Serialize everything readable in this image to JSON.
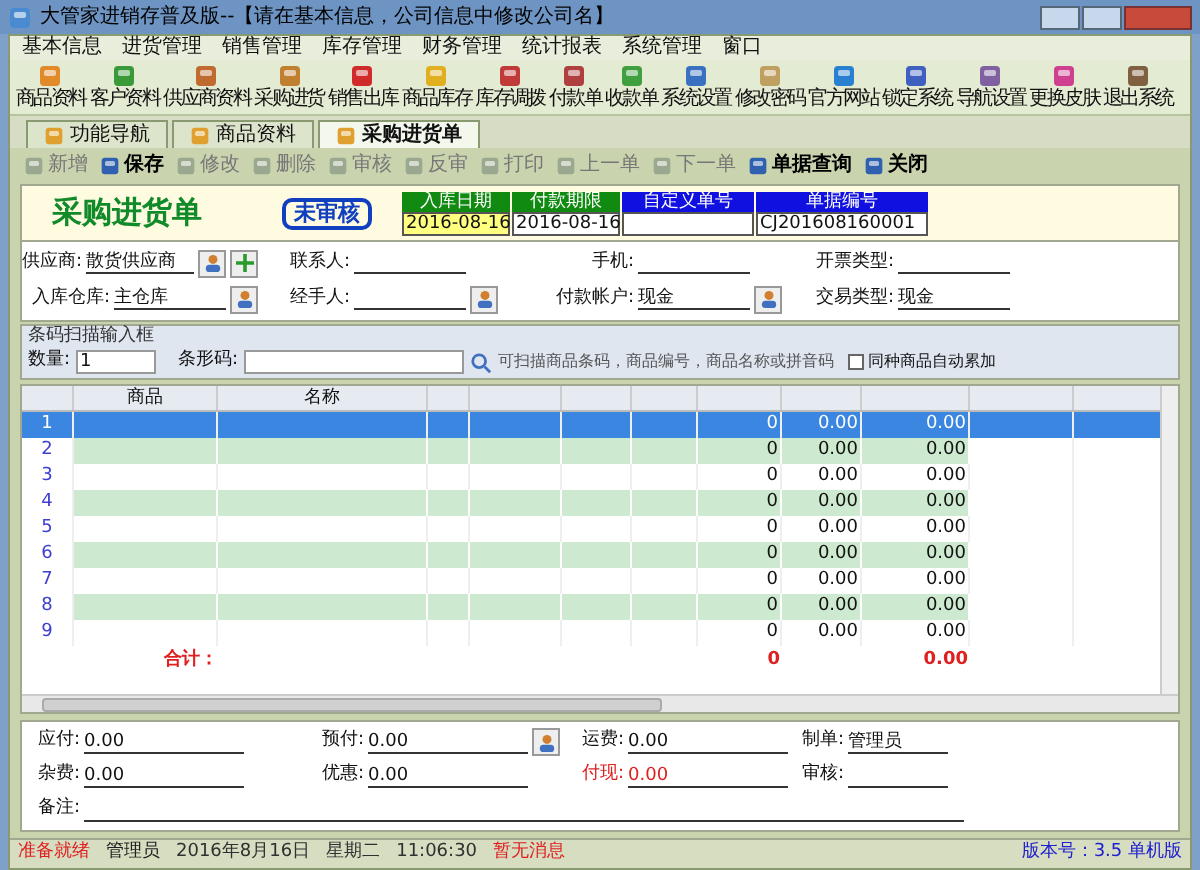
{
  "window": {
    "title": "大管家进销存普及版--【请在基本信息，公司信息中修改公司名】"
  },
  "menu": [
    "基本信息",
    "进货管理",
    "销售管理",
    "库存管理",
    "财务管理",
    "统计报表",
    "系统管理",
    "窗口"
  ],
  "toolbar": [
    {
      "label": "商品资料",
      "color": "#e08a2a"
    },
    {
      "label": "客户资料",
      "color": "#3a9a3a"
    },
    {
      "label": "供应商资料",
      "color": "#c06a30"
    },
    {
      "label": "采购进货",
      "color": "#c08030"
    },
    {
      "label": "销售出库",
      "color": "#d02a2a"
    },
    {
      "label": "商品库存",
      "color": "#e0b020"
    },
    {
      "label": "库存调拨",
      "color": "#c03a3a"
    },
    {
      "label": "付款单",
      "color": "#b04040"
    },
    {
      "label": "收款单",
      "color": "#40a040"
    },
    {
      "label": "系统设置",
      "color": "#3a70c0"
    },
    {
      "label": "修改密码",
      "color": "#c0a060"
    },
    {
      "label": "官方网站",
      "color": "#2a80d0"
    },
    {
      "label": "锁定系统",
      "color": "#4060c0"
    },
    {
      "label": "导航设置",
      "color": "#8060a0"
    },
    {
      "label": "更换皮肤",
      "color": "#d04090"
    },
    {
      "label": "退出系统",
      "color": "#806040"
    }
  ],
  "tabs": [
    {
      "label": "功能导航",
      "selected": false
    },
    {
      "label": "商品资料",
      "selected": false
    },
    {
      "label": "采购进货单",
      "selected": true
    }
  ],
  "actions": [
    {
      "label": "新增",
      "disabled": true
    },
    {
      "label": "保存",
      "disabled": false
    },
    {
      "label": "修改",
      "disabled": true
    },
    {
      "label": "删除",
      "disabled": true
    },
    {
      "label": "审核",
      "disabled": true
    },
    {
      "label": "反审",
      "disabled": true
    },
    {
      "label": "打印",
      "disabled": true
    },
    {
      "label": "上一单",
      "disabled": true
    },
    {
      "label": "下一单",
      "disabled": true
    },
    {
      "label": "单据查询",
      "disabled": false
    },
    {
      "label": "关闭",
      "disabled": false
    }
  ],
  "document": {
    "title": "采购进货单",
    "stamp": "未审核",
    "header_fields": [
      {
        "label": "入库日期",
        "value": "2016-08-16",
        "color": "#108a10",
        "selected": true
      },
      {
        "label": "付款期限",
        "value": "2016-08-16",
        "color": "#108a10",
        "selected": false
      },
      {
        "label": "自定义单号",
        "color": "#1010e0",
        "selected": false
      },
      {
        "label": "单据编号",
        "value": "CJ201608160001",
        "color": "#1010e0",
        "selected": false
      }
    ]
  },
  "form": [
    [
      {
        "label": "供应商:",
        "value": "散货供应商",
        "kind": "pick_add"
      },
      {
        "label": "联系人:",
        "kind": "plain"
      },
      {
        "label": "手机:",
        "kind": "plain"
      },
      {
        "label": "开票类型:",
        "kind": "plain"
      }
    ],
    [
      {
        "label": "入库仓库:",
        "value": "主仓库",
        "kind": "pick"
      },
      {
        "label": "经手人:",
        "kind": "pick"
      },
      {
        "label": "付款帐户:",
        "value": "现金",
        "kind": "pick"
      },
      {
        "label": "交易类型:",
        "value": "现金",
        "kind": "plain"
      }
    ]
  ],
  "barcode": {
    "title": "条码扫描输入框",
    "quantity_label": "数量:",
    "quantity": "1",
    "code_label": "条形码:",
    "hint": "可扫描商品条码，商品编号，商品名称或拼音码",
    "auto_sum": {
      "label": "同种商品自动累加",
      "checked": false
    }
  },
  "grid": {
    "columns": [
      {
        "label": "商品"
      },
      {
        "label": "名称"
      }
    ],
    "rows": [
      {
        "number": "1",
        "quantity": "0",
        "price": "0.00",
        "amount": "0.00",
        "selected": true
      },
      {
        "number": "2",
        "quantity": "0",
        "price": "0.00",
        "amount": "0.00",
        "selected": false
      },
      {
        "number": "3",
        "quantity": "0",
        "price": "0.00",
        "amount": "0.00",
        "selected": false
      },
      {
        "number": "4",
        "quantity": "0",
        "price": "0.00",
        "amount": "0.00",
        "selected": false
      },
      {
        "number": "5",
        "quantity": "0",
        "price": "0.00",
        "amount": "0.00",
        "selected": false
      },
      {
        "number": "6",
        "quantity": "0",
        "price": "0.00",
        "amount": "0.00",
        "selected": false
      },
      {
        "number": "7",
        "quantity": "0",
        "price": "0.00",
        "amount": "0.00",
        "selected": false
      },
      {
        "number": "8",
        "quantity": "0",
        "price": "0.00",
        "amount": "0.00",
        "selected": false
      },
      {
        "number": "9",
        "quantity": "0",
        "price": "0.00",
        "amount": "0.00",
        "selected": false
      }
    ],
    "total": {
      "label": "合计：",
      "quantity": "0",
      "amount": "0.00"
    }
  },
  "footer": [
    [
      {
        "label": "应付:",
        "value": "0.00",
        "kind": "plain"
      },
      {
        "label": "预付:",
        "value": "0.00",
        "kind": "pick"
      },
      {
        "label": "运费:",
        "value": "0.00",
        "kind": "plain"
      },
      {
        "label": "制单:",
        "value": "管理员",
        "kind": "plain"
      }
    ],
    [
      {
        "label": "杂费:",
        "value": "0.00",
        "kind": "plain"
      },
      {
        "label": "优惠:",
        "value": "0.00",
        "kind": "plain"
      },
      {
        "label": "付现:",
        "value": "0.00",
        "kind": "alert"
      },
      {
        "label": "审核:",
        "kind": "plain"
      }
    ],
    [
      {
        "label": "备注:",
        "kind": "wide"
      }
    ]
  ],
  "status_bar": [
    {
      "text": "准备就绪",
      "color": "#e02020"
    },
    {
      "text": "管理员",
      "color": "#202020"
    },
    {
      "text": "2016年8月16日",
      "color": "#303030"
    },
    {
      "text": "星期二",
      "color": "#303030"
    },
    {
      "text": "11:06:30",
      "color": "#303030"
    },
    {
      "text": "暂无消息",
      "color": "#e02020"
    },
    {
      "text": "版本号：3.5 单机版",
      "color": "#2020d0"
    }
  ]
}
